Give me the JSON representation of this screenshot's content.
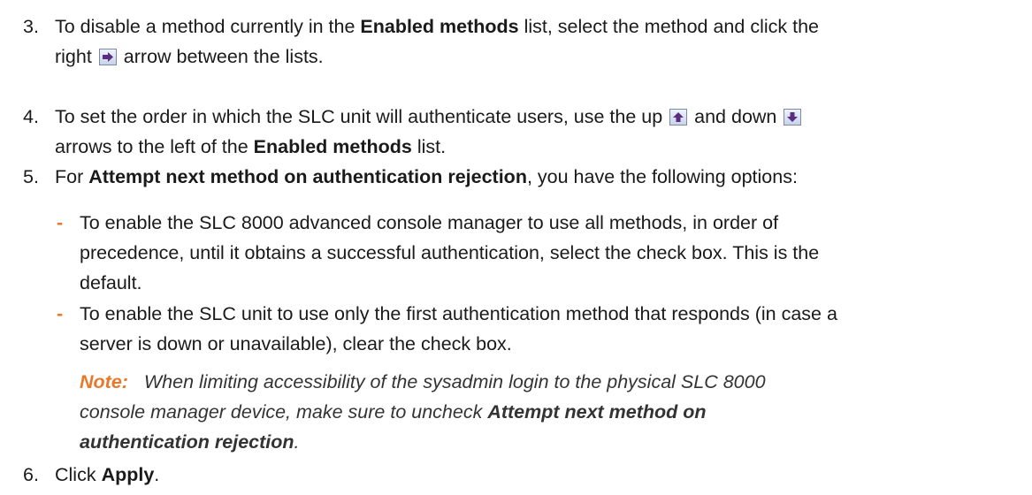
{
  "steps": [
    {
      "num": "3.",
      "t1": "To disable a method currently in the ",
      "b1": "Enabled methods",
      "t2": " list, select the method and click the",
      "t3": "right ",
      "t4": " arrow between the lists."
    },
    {
      "num": "4.",
      "t1": "To set the order in which the SLC unit will authenticate users, use the up ",
      "t2": " and down ",
      "t3": "arrows to the left of the ",
      "b1": "Enabled methods",
      "t4": " list."
    },
    {
      "num": "5.",
      "t1": "For ",
      "b1": "Attempt next method on authentication rejection",
      "t2": ", you have the following options:"
    },
    {
      "num": "6.",
      "t1": "Click ",
      "b1": "Apply",
      "t2": "."
    }
  ],
  "options": [
    {
      "dash": "-",
      "lines": [
        "To enable the SLC 8000 advanced console manager to use all methods, in order of",
        "precedence, until it obtains a successful authentication, select the check box. This is the",
        "default."
      ]
    },
    {
      "dash": "-",
      "lines": [
        "To enable the SLC unit to use only the first authentication method that responds (in case a",
        "server is down or unavailable), clear the check box."
      ]
    }
  ],
  "note": {
    "label": "Note:",
    "l1": "When limiting accessibility of the sysadmin login to the physical SLC 8000",
    "l2a": "console manager device, make sure to uncheck ",
    "l2b": "Attempt next method on",
    "l3a": "authentication rejection",
    "l3b": "."
  },
  "colors": {
    "accent": "#e8792b",
    "arrow": "#5a2d82"
  },
  "icons": [
    "right-arrow-icon",
    "up-arrow-icon",
    "down-arrow-icon"
  ]
}
